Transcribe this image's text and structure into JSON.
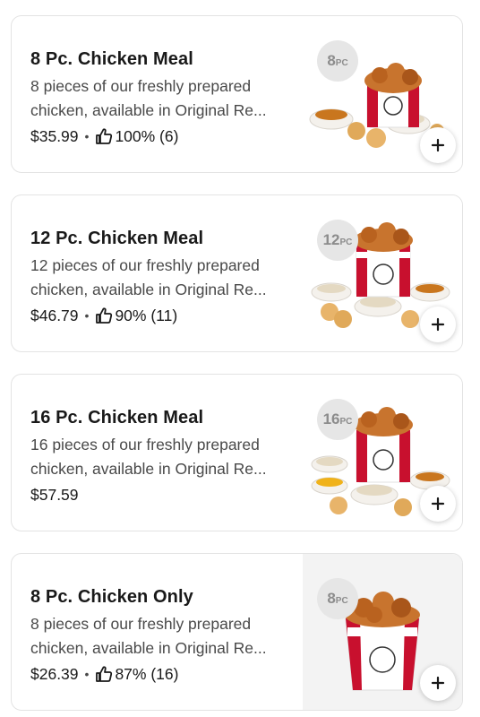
{
  "items": [
    {
      "title": "8 Pc. Chicken Meal",
      "description": "8 pieces of our freshly prepared",
      "description2": "chicken, available in Original Re...",
      "price": "$35.99",
      "rating": "100% (6)",
      "badge_num": "8",
      "badge_unit": "PC"
    },
    {
      "title": "12 Pc. Chicken Meal",
      "description": "12 pieces of our freshly prepared",
      "description2": "chicken, available in Original Re...",
      "price": "$46.79",
      "rating": "90% (11)",
      "badge_num": "12",
      "badge_unit": "PC"
    },
    {
      "title": "16 Pc. Chicken Meal",
      "description": "16 pieces of our freshly prepared",
      "description2": "chicken, available in Original Re...",
      "price": "$57.59",
      "badge_num": "16",
      "badge_unit": "PC"
    },
    {
      "title": "8 Pc. Chicken Only",
      "description": "8 pieces of our freshly prepared",
      "description2": "chicken, available in Original Re...",
      "price": "$26.39",
      "rating": "87% (16)",
      "badge_num": "8",
      "badge_unit": "PC"
    }
  ],
  "separator": "•",
  "add_symbol": "+",
  "colors": {
    "badge_bg": "#e6e6e6",
    "bucket_red": "#c8102e",
    "chicken": "#c8742e"
  }
}
